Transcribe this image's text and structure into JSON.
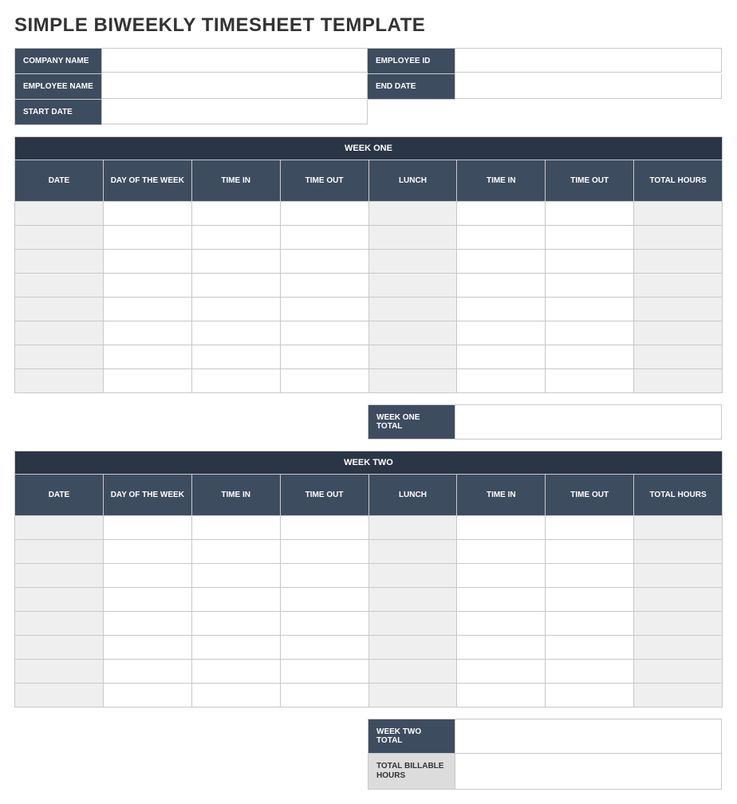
{
  "title": "SIMPLE BIWEEKLY TIMESHEET TEMPLATE",
  "info": {
    "company_name_label": "COMPANY NAME",
    "company_name_value": "",
    "employee_id_label": "EMPLOYEE ID",
    "employee_id_value": "",
    "employee_name_label": "EMPLOYEE NAME",
    "employee_name_value": "",
    "end_date_label": "END DATE",
    "end_date_value": "",
    "start_date_label": "START DATE",
    "start_date_value": ""
  },
  "week_one": {
    "title": "WEEK ONE",
    "headers": {
      "date": "DATE",
      "day": "DAY OF THE WEEK",
      "time_in1": "TIME IN",
      "time_out1": "TIME OUT",
      "lunch": "LUNCH",
      "time_in2": "TIME IN",
      "time_out2": "TIME OUT",
      "total": "TOTAL HOURS"
    },
    "total_label": "WEEK ONE TOTAL",
    "total_value": ""
  },
  "week_two": {
    "title": "WEEK TWO",
    "headers": {
      "date": "DATE",
      "day": "DAY OF THE WEEK",
      "time_in1": "TIME IN",
      "time_out1": "TIME OUT",
      "lunch": "LUNCH",
      "time_in2": "TIME IN",
      "time_out2": "TIME OUT",
      "total": "TOTAL HOURS"
    },
    "total_label": "WEEK TWO TOTAL",
    "total_value": ""
  },
  "billable": {
    "label": "TOTAL BILLABLE HOURS",
    "value": ""
  }
}
